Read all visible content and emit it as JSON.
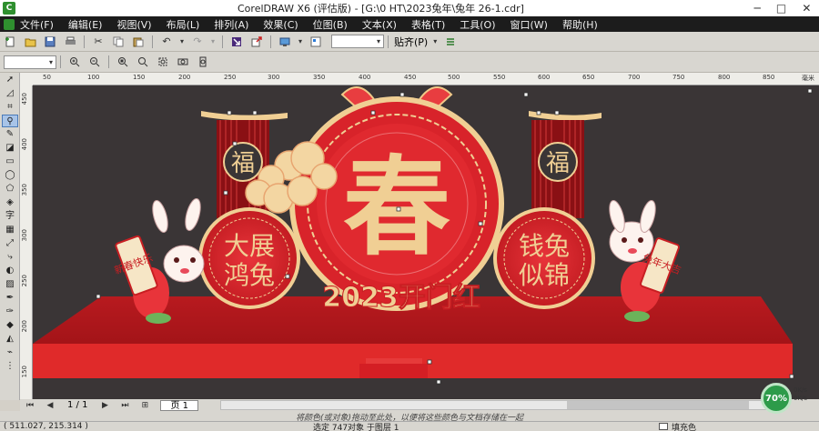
{
  "window": {
    "title": "CorelDRAW X6 (评估版) - [G:\\0 HT\\2023兔年\\兔年 26-1.cdr]",
    "app_icon": "coreldraw-app-icon",
    "minimize": "─",
    "maximize": "□",
    "close": "✕"
  },
  "menu": {
    "items": [
      "文件(F)",
      "编辑(E)",
      "视图(V)",
      "布局(L)",
      "排列(A)",
      "效果(C)",
      "位图(B)",
      "文本(X)",
      "表格(T)",
      "工具(O)",
      "窗口(W)",
      "帮助(H)"
    ]
  },
  "toolbar": {
    "snap_label": "贴齐(P)",
    "snap_arrow": "▾",
    "zoom_value": "",
    "combo_arrow": "▾"
  },
  "property_bar": {
    "units_value": ""
  },
  "rulers": {
    "top_ticks": [
      "50",
      "100",
      "150",
      "200",
      "250",
      "300",
      "350",
      "400",
      "450",
      "500",
      "550",
      "600",
      "650",
      "700",
      "750",
      "800",
      "850"
    ],
    "left_ticks": [
      "450",
      "400",
      "350",
      "300",
      "250",
      "200",
      "150"
    ],
    "unit_label": "毫米"
  },
  "artwork": {
    "main_char": "春",
    "fu_char": "福",
    "left_circle_text": [
      "大展",
      "鸿兔"
    ],
    "right_circle_text": [
      "钱兔",
      "似锦"
    ],
    "banner_text": "2023开门红",
    "left_scroll_text": "新春快乐",
    "right_scroll_text": "兔年大吉",
    "colors": {
      "red": "#d8232a",
      "gold": "#f2d39a",
      "dark_bg": "#3a3536",
      "stage": "#c81e22"
    }
  },
  "pagebar": {
    "page_count": "1 / 1",
    "page_tab": "页 1"
  },
  "hint": "将颜色(或对象)拖动至此处，以便将这些颜色与文档存储在一起",
  "status": {
    "coords": "( 511.027, 215.314 )",
    "selection": "选定 747对象 于图层 1",
    "fill_label": "填充色"
  },
  "zoom_badge": "70%",
  "speed": {
    "up": "0K/s",
    "down": "0K/s"
  }
}
